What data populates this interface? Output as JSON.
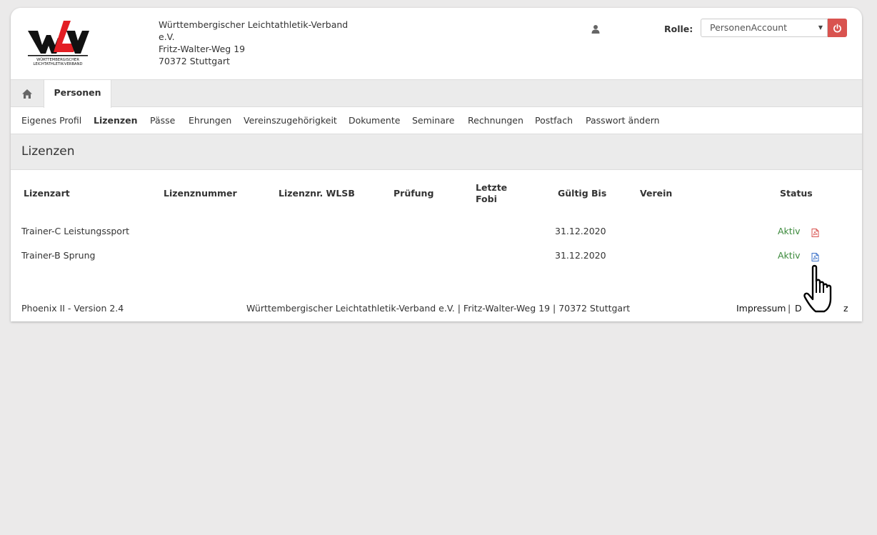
{
  "header": {
    "org_line1": "Württembergischer Leichtathletik-Verband",
    "org_line2": "e.V.",
    "street": "Fritz-Walter-Weg 19",
    "city": "70372 Stuttgart",
    "logo_subtext1": "WÜRTTEMBERGISCHER",
    "logo_subtext2": "LEICHTATHLETIK-VERBAND",
    "role_label": "Rolle:",
    "role_value": "PersonenAccount",
    "user_icon": "user-icon",
    "logout_icon": "power-icon"
  },
  "tabs": {
    "home_icon": "home-icon",
    "personen": "Personen"
  },
  "subnav": [
    {
      "label": "Eigenes Profil",
      "active": false
    },
    {
      "label": "Lizenzen",
      "active": true
    },
    {
      "label": "Pässe",
      "active": false
    },
    {
      "label": "Ehrungen",
      "active": false
    },
    {
      "label": "Vereinszugehörigkeit",
      "active": false
    },
    {
      "label": "Dokumente",
      "active": false
    },
    {
      "label": "Seminare",
      "active": false
    },
    {
      "label": "Rechnungen",
      "active": false
    },
    {
      "label": "Postfach",
      "active": false
    },
    {
      "label": "Passwort ändern",
      "active": false
    }
  ],
  "section_title": "Lizenzen",
  "table": {
    "headers": {
      "lizenzart": "Lizenzart",
      "lizenznummer": "Lizenznummer",
      "lizenznr_wlsb": "Lizenznr. WLSB",
      "pruefung": "Prüfung",
      "letzte_fobi_1": "Letzte",
      "letzte_fobi_2": "Fobi",
      "gueltig_bis": "Gültig Bis",
      "verein": "Verein",
      "status": "Status"
    },
    "rows": [
      {
        "lizenzart": "Trainer-C Leistungssport",
        "gueltig_bis": "31.12.2020",
        "status": "Aktiv",
        "pdf_icon": "pdf-icon"
      },
      {
        "lizenzart": "Trainer-B Sprung",
        "gueltig_bis": "31.12.2020",
        "status": "Aktiv",
        "pdf_icon": "pdf-icon"
      }
    ]
  },
  "footer": {
    "version": "Phoenix II - Version 2.4",
    "address": "Württembergischer Leichtathletik-Verband e.V. | Fritz-Walter-Weg 19 | 70372 Stuttgart",
    "impressum": "Impressum",
    "separator": "|",
    "datenschutz_visible_start": "D",
    "datenschutz_visible_end": "z"
  },
  "colors": {
    "accent_red": "#d9534f",
    "status_green": "#3c8a3c",
    "pdf_red": "#d9534f",
    "pdf_blue": "#3a70c8",
    "background": "#ebeaea"
  }
}
